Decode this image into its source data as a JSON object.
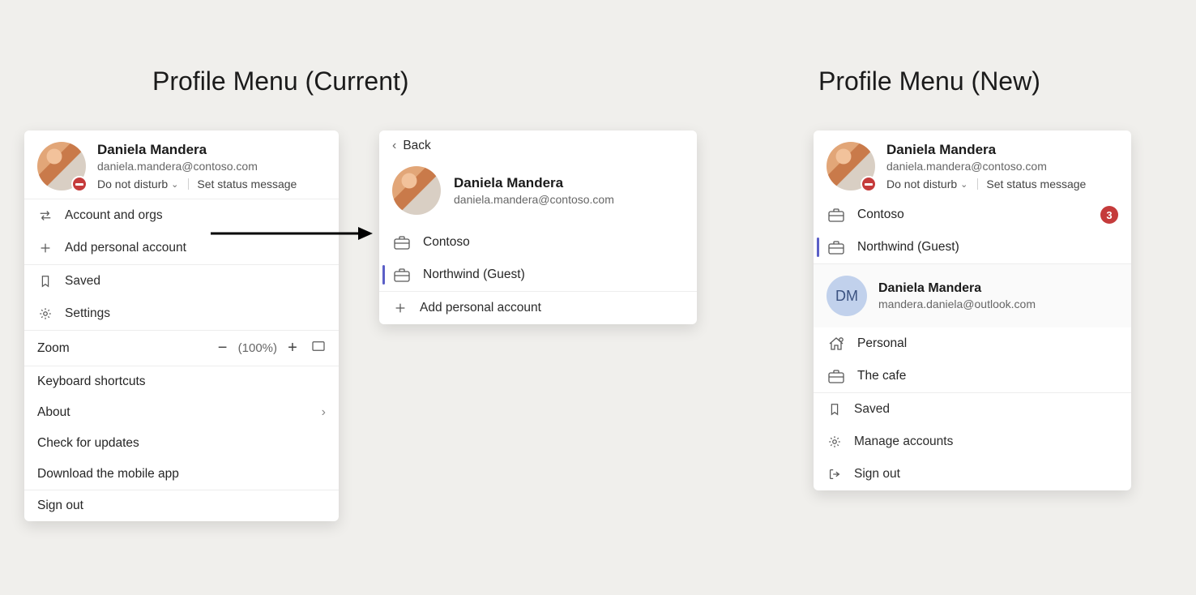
{
  "headings": {
    "current": "Profile Menu (Current)",
    "new_": "Profile Menu (New)"
  },
  "user": {
    "name": "Daniela Mandera",
    "email": "daniela.mandera@contoso.com",
    "status": "Do not disturb",
    "setStatus": "Set status message"
  },
  "currentMenu": {
    "accountOrgs": "Account and orgs",
    "addPersonal": "Add personal account",
    "saved": "Saved",
    "settings": "Settings",
    "zoomLabel": "Zoom",
    "zoomValue": "(100%)",
    "keyboard": "Keyboard shortcuts",
    "about": "About",
    "checkUpdates": "Check for updates",
    "download": "Download the mobile app",
    "signOut": "Sign out"
  },
  "orgsPanel": {
    "back": "Back",
    "orgs": [
      {
        "name": "Contoso",
        "selected": false
      },
      {
        "name": "Northwind (Guest)",
        "selected": true
      }
    ],
    "addPersonal": "Add personal account"
  },
  "newMenu": {
    "primaryOrgs": [
      {
        "name": "Contoso",
        "selected": false,
        "badge": "3"
      },
      {
        "name": "Northwind (Guest)",
        "selected": true
      }
    ],
    "secondary": {
      "initials": "DM",
      "name": "Daniela Mandera",
      "email": "mandera.daniela@outlook.com"
    },
    "secondaryOrgs": [
      {
        "name": "Personal",
        "iconHome": true
      },
      {
        "name": "The cafe"
      }
    ],
    "saved": "Saved",
    "manage": "Manage accounts",
    "signOut": "Sign out"
  }
}
